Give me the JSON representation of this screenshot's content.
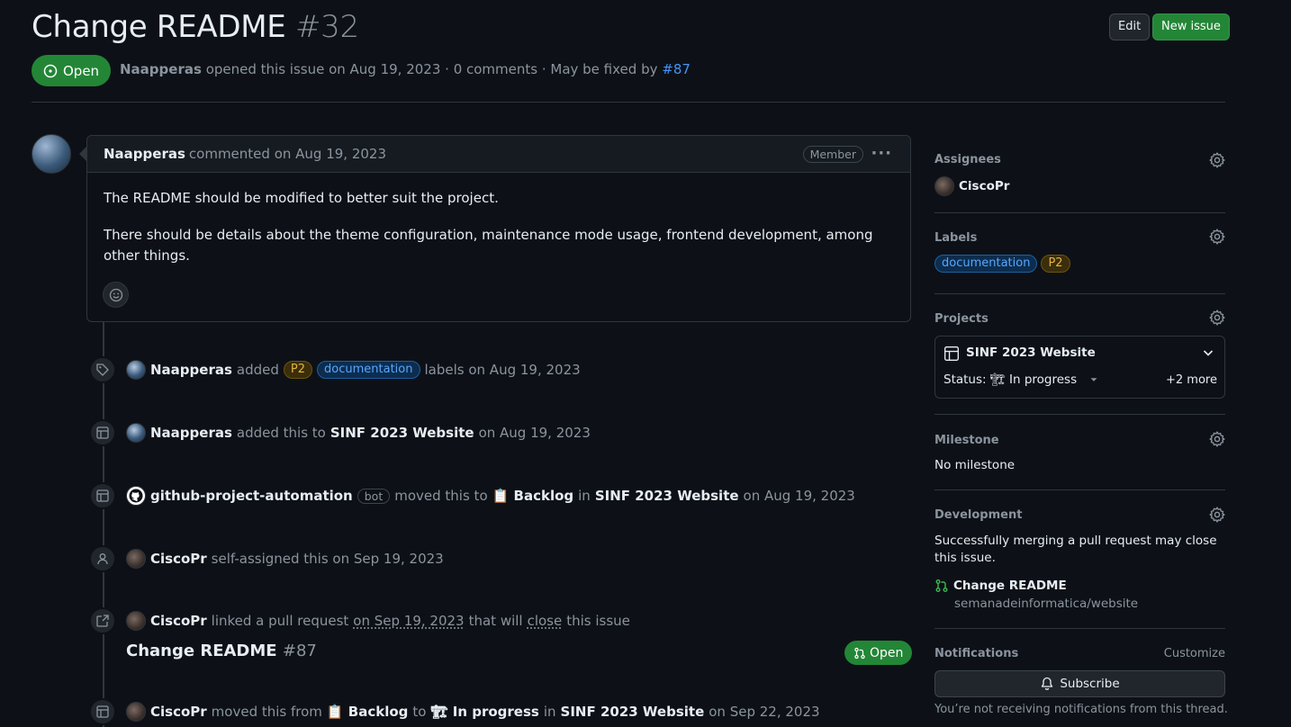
{
  "issue": {
    "title": "Change README",
    "number": "#32",
    "state": "Open",
    "author": "Naapperas",
    "opened_text": "opened this issue on Aug 19, 2023 · 0 comments · May be fixed by",
    "fixed_by": "#87"
  },
  "header_buttons": {
    "edit": "Edit",
    "new_issue": "New issue"
  },
  "comment": {
    "author": "Naapperas",
    "when": "commented on Aug 19, 2023",
    "role": "Member",
    "menu": "···",
    "paragraphs": [
      "The README should be modified to better suit the project.",
      "There should be details about the theme configuration, maintenance mode usage, frontend development, among other things."
    ]
  },
  "timeline": {
    "e1": {
      "actor": "Naapperas",
      "action": "added",
      "label1": "P2",
      "label2": "documentation",
      "tail": "labels on Aug 19, 2023"
    },
    "e2": {
      "actor": "Naapperas",
      "action": "added this to",
      "project": "SINF 2023 Website",
      "tail": "on Aug 19, 2023"
    },
    "e3": {
      "actor": "github-project-automation",
      "badge": "bot",
      "action": "moved this to",
      "column": "📋 Backlog",
      "in": "in",
      "project": "SINF 2023 Website",
      "tail": "on Aug 19, 2023"
    },
    "e4": {
      "actor": "CiscoPr",
      "tail": "self-assigned this on Sep 19, 2023"
    },
    "e5": {
      "actor": "CiscoPr",
      "action": "linked a pull request",
      "date": "on Sep 19, 2023",
      "that_will": "that will",
      "close": "close",
      "tail": "this issue"
    },
    "pr": {
      "title": "Change README",
      "number": "#87",
      "state": "Open"
    },
    "e6": {
      "actor": "CiscoPr",
      "action": "moved this from",
      "from": "📋 Backlog",
      "to": "to",
      "target": "🏗 In progress",
      "in": "in",
      "project": "SINF 2023 Website",
      "tail": "on Sep 22, 2023"
    }
  },
  "sidebar": {
    "assignees": {
      "heading": "Assignees",
      "user": "CiscoPr"
    },
    "labels": {
      "heading": "Labels",
      "items": [
        "documentation",
        "P2"
      ]
    },
    "projects": {
      "heading": "Projects",
      "name": "SINF 2023 Website",
      "status_label": "Status:",
      "status_value": "🏗 In progress",
      "more": "+2 more"
    },
    "milestone": {
      "heading": "Milestone",
      "value": "No milestone"
    },
    "development": {
      "heading": "Development",
      "note": "Successfully merging a pull request may close this issue.",
      "pr_title": "Change README",
      "repo": "semanadeinformatica/website"
    },
    "notifications": {
      "heading": "Notifications",
      "customize": "Customize",
      "subscribe": "Subscribe",
      "note": "You’re not receiving notifications from this thread."
    }
  },
  "colors": {
    "background": "#0d1117",
    "open_green": "#238636",
    "link_blue": "#4493f8",
    "muted": "#8b949e"
  }
}
